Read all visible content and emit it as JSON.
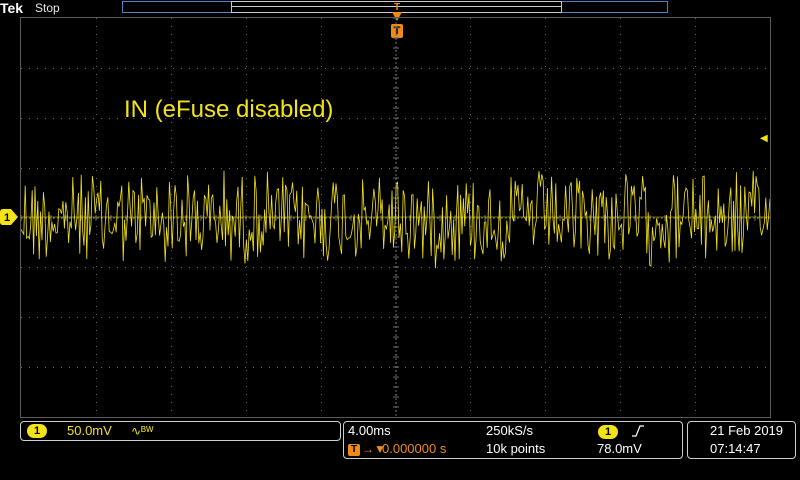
{
  "header": {
    "brand_tek": "Tek",
    "acquisition_state": "Stop"
  },
  "trigger_position_marker": "T",
  "annotation_text": "IN (eFuse disabled)",
  "channel1": {
    "badge": "1",
    "scale": "50.0mV",
    "bandwidth_limit_icon": "bw-limit-icon",
    "color": "#f2e21a"
  },
  "horizontal": {
    "time_per_div": "4.00ms",
    "sample_rate": "250kS/s",
    "trigger_icon": "T",
    "trigger_delay": "0.000000 s",
    "record_length": "10k points"
  },
  "trigger": {
    "source_badge": "1",
    "slope_icon": "rising-edge-icon",
    "level": "78.0mV",
    "color": "#f08a16"
  },
  "datetime": {
    "date": "21 Feb  2019",
    "time": "07:14:47"
  }
}
